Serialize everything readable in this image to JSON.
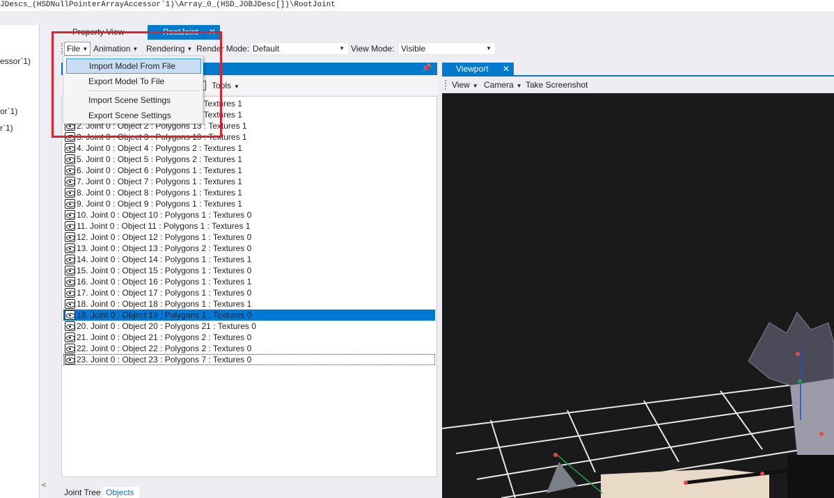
{
  "path_bar": {
    "text": "JDescs_(HSDNullPointerArrayAccessor`1)\\Array_0_(HSD_JOBJDesc[])\\RootJoint"
  },
  "left_tree": {
    "fragments": [
      "essor`1)",
      "or`1)",
      "r`1)"
    ],
    "collapse_label": "<"
  },
  "document_tabs": {
    "property_view": "Property View",
    "root_joint": "RootJoint"
  },
  "toolbar": {
    "file": "File",
    "animation": "Animation",
    "rendering": "Rendering",
    "render_mode_label": "Render Mode:",
    "render_mode_value": "Default",
    "view_mode_label": "View Mode:",
    "view_mode_value": "Visible"
  },
  "file_menu": {
    "items": [
      "Import Model From File",
      "Export Model To File",
      "Import Scene Settings",
      "Export Scene Settings"
    ],
    "highlighted_index": 0
  },
  "objects_pane": {
    "tools_label": "Tools",
    "rows": [
      "0. Joint 0 : Object 0 : Polygons 1 : Textures 1",
      "1. Joint 0 : Object 1 : Polygons 1 : Textures 1",
      "2. Joint 0 : Object 2 : Polygons 13 : Textures 1",
      "3. Joint 0 : Object 3 : Polygons 10 : Textures 1",
      "4. Joint 0 : Object 4 : Polygons 2 : Textures 1",
      "5. Joint 0 : Object 5 : Polygons 2 : Textures 1",
      "6. Joint 0 : Object 6 : Polygons 1 : Textures 1",
      "7. Joint 0 : Object 7 : Polygons 1 : Textures 1",
      "8. Joint 0 : Object 8 : Polygons 1 : Textures 1",
      "9. Joint 0 : Object 9 : Polygons 1 : Textures 1",
      "10. Joint 0 : Object 10 : Polygons 1 : Textures 0",
      "11. Joint 0 : Object 11 : Polygons 1 : Textures 1",
      "12. Joint 0 : Object 12 : Polygons 1 : Textures 0",
      "13. Joint 0 : Object 13 : Polygons 2 : Textures 0",
      "14. Joint 0 : Object 14 : Polygons 1 : Textures 1",
      "15. Joint 0 : Object 15 : Polygons 1 : Textures 0",
      "16. Joint 0 : Object 16 : Polygons 1 : Textures 1",
      "17. Joint 0 : Object 17 : Polygons 1 : Textures 0",
      "18. Joint 0 : Object 18 : Polygons 1 : Textures 1",
      "19. Joint 0 : Object 19 : Polygons 1 : Textures 0",
      "20. Joint 0 : Object 20 : Polygons 21 : Textures 0",
      "21. Joint 0 : Object 21 : Polygons 2 : Textures 0",
      "22. Joint 0 : Object 22 : Polygons 2 : Textures 0",
      "23. Joint 0 : Object 23 : Polygons 7 : Textures 0"
    ],
    "selected_index": 19,
    "focused_index": 23,
    "bottom_tabs": [
      "Joint Tree",
      "Objects"
    ],
    "active_bottom_tab": "Objects"
  },
  "viewport": {
    "tab_label": "Viewport",
    "close_glyph": "✕",
    "toolbar": {
      "view": "View",
      "camera": "Camera",
      "screenshot": "Take Screenshot"
    }
  },
  "colors": {
    "accent": "#007acc",
    "selection": "#0078d7",
    "highlight_box": "#e0202a",
    "menu_hover": "#c9def5",
    "viewport_bg": "#1a1a1a"
  }
}
